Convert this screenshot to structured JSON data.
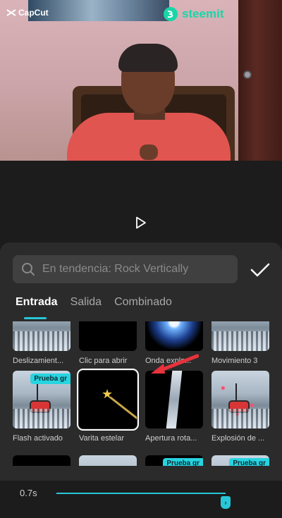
{
  "preview": {
    "watermark_left": "CapCut",
    "watermark_right": "steemit"
  },
  "panel": {
    "search_placeholder": "En tendencia: Rock Vertically",
    "tabs": [
      {
        "label": "Entrada",
        "active": true
      },
      {
        "label": "Salida",
        "active": false
      },
      {
        "label": "Combinado",
        "active": false
      }
    ],
    "effects": [
      {
        "label": "Deslizamient...",
        "thumb": "snow"
      },
      {
        "label": "Clic para abrir",
        "thumb": "dark"
      },
      {
        "label": "Onda explo...",
        "thumb": "sparkle"
      },
      {
        "label": "Movimiento 3",
        "thumb": "snow"
      },
      {
        "label": "Flash activado",
        "thumb": "snow-gondola",
        "badge": "Prueba gr"
      },
      {
        "label": "Varita estelar",
        "thumb": "wand",
        "selected": true
      },
      {
        "label": "Apertura rota...",
        "thumb": "slice"
      },
      {
        "label": "Explosión de ...",
        "thumb": "snow-gondola-dots"
      },
      {
        "label": "",
        "thumb": "dark"
      },
      {
        "label": "",
        "thumb": "snow-gondola"
      },
      {
        "label": "",
        "thumb": "dark",
        "badge": "Prueba gr"
      },
      {
        "label": "",
        "thumb": "snow",
        "badge": "Prueba gr"
      }
    ],
    "badge_text": "Prueba gr"
  },
  "timeline": {
    "duration": "0.7s",
    "slider_fraction": 1.0
  },
  "colors": {
    "accent": "#27c7d8",
    "steemit": "#19d6a8",
    "arrow": "#e8323c"
  },
  "icons": [
    "capcut-logo-icon",
    "steemit-logo-icon",
    "play-icon",
    "search-icon",
    "checkmark-icon",
    "red-arrow-icon"
  ]
}
